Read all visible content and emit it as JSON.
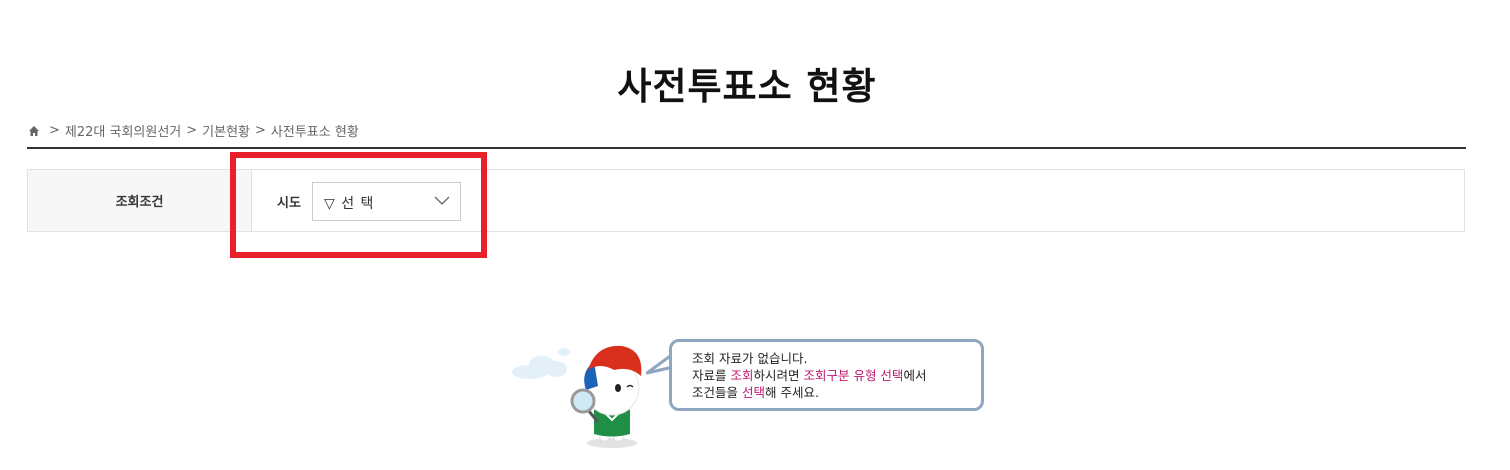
{
  "page_title": "사전투표소 현황",
  "breadcrumb": {
    "home_icon": "home-icon",
    "separator": ">",
    "items": [
      "제22대 국회의원선거",
      "기본현황",
      "사전투표소 현황"
    ]
  },
  "search": {
    "condition_label": "조회조건",
    "region_label": "시도",
    "region_select": {
      "selected": "▽ 선 택",
      "icon": "chevron-down-icon"
    }
  },
  "empty_state": {
    "mascot": "election-mascot-with-magnifier",
    "line1": "조회 자료가 없습니다.",
    "line2": {
      "p1": "자료를 ",
      "h1": "조회",
      "p2": "하시려면 ",
      "h2": "조회구분 유형 선택",
      "p3": "에서"
    },
    "line3": {
      "p1": "조건들을 ",
      "h1": "선택",
      "p2": "해 주세요."
    }
  },
  "colors": {
    "highlight_box": "#e8202a",
    "accent_text": "#c0186f",
    "bubble_border": "#8ea6bf"
  }
}
